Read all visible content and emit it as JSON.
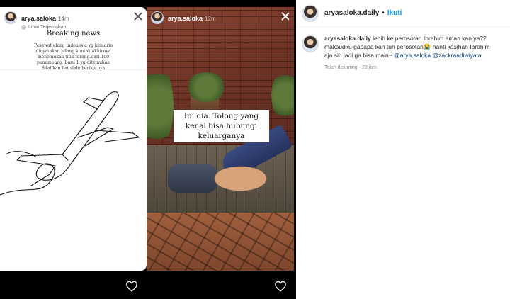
{
  "story_left": {
    "username": "arya.saloka",
    "age": "14m",
    "translation_link": "Lihat Terjemahan",
    "title": "Breaking news",
    "body": "Pesawat elang indonesia yg kemarin dinyatakan hilang kontak,akhirnya menemukan titik terang.dari 100 penumpang, baru 1 yg ditemukan Silahkan liat slide berikutnya"
  },
  "story_middle": {
    "username": "arya.saloka",
    "age": "12m",
    "caption": "Ini dia. Tolong yang kenal bisa hubungi keluarganya"
  },
  "post": {
    "username": "aryasaloka.daily",
    "separator": "•",
    "follow_label": "Ikuti",
    "comment_user": "aryasaloka.daily",
    "comment_text": "lebih ke perosotan Ibrahim aman kan ya?? maksudku gapapa kan tuh perosotan😭 nanti kasihan Ibrahim aja sih jadi ga bisa main~",
    "mention_1": "@arya.saloka",
    "mention_2": "@zackraadiwiyata",
    "meta": "Telah disunting · 23 jam"
  },
  "icons": {
    "close": "close-icon",
    "like": "heart-icon",
    "translate": "translate-icon"
  }
}
